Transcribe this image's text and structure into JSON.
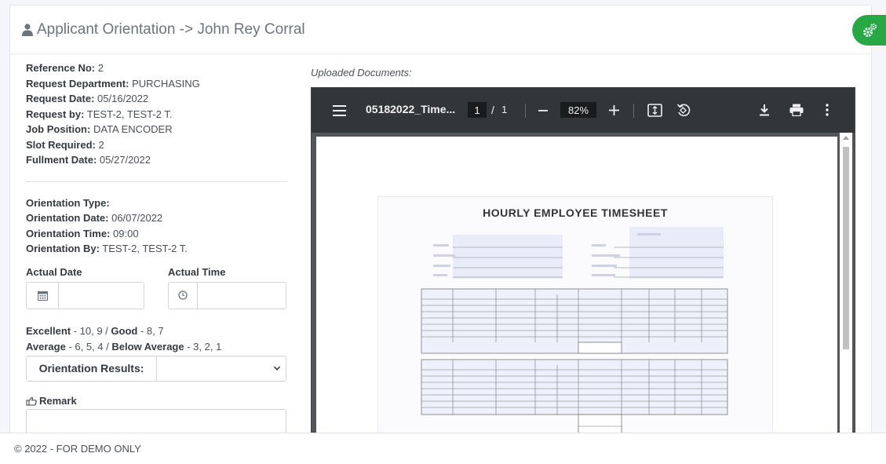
{
  "header": {
    "title": "Applicant Orientation -> John Rey Corral",
    "icon": "user-icon"
  },
  "request": {
    "fields": [
      {
        "label": "Reference No:",
        "value": "2"
      },
      {
        "label": "Request Department:",
        "value": "PURCHASING"
      },
      {
        "label": "Request Date:",
        "value": "05/16/2022"
      },
      {
        "label": "Request by:",
        "value": "TEST-2, TEST-2 T."
      },
      {
        "label": "Job Position:",
        "value": "DATA ENCODER"
      },
      {
        "label": "Slot Required:",
        "value": "2"
      },
      {
        "label": "Fullment Date:",
        "value": "05/27/2022"
      }
    ]
  },
  "orientation": {
    "fields": [
      {
        "label": "Orientation Type:",
        "value": ""
      },
      {
        "label": "Orientation Date:",
        "value": "06/07/2022"
      },
      {
        "label": "Orientation Time:",
        "value": "09:00"
      },
      {
        "label": "Orientation By:",
        "value": "TEST-2, TEST-2 T."
      }
    ]
  },
  "actual": {
    "date_label": "Actual Date",
    "time_label": "Actual Time",
    "date_value": "",
    "time_value": ""
  },
  "rating": {
    "excellent_label": "Excellent",
    "excellent_values": " - 10, 9 / ",
    "good_label": "Good",
    "good_values": " - 8, 7",
    "average_label": "Average",
    "average_values": " - 6, 5, 4 / ",
    "below_label": "Below Average",
    "below_values": " - 3, 2, 1"
  },
  "results": {
    "label": "Orientation Results:",
    "selected": ""
  },
  "remark": {
    "label": "Remark",
    "value": ""
  },
  "documents": {
    "label": "Uploaded Documents:",
    "viewer": {
      "file_name": "05182022_Time...",
      "current_page": "1",
      "page_sep": "/",
      "total_pages": "1",
      "zoom": "82%",
      "sheet_title": "HOURLY EMPLOYEE TIMESHEET"
    }
  },
  "footer": {
    "text": "© 2022 - FOR DEMO ONLY"
  },
  "colors": {
    "accent": "#28a745",
    "toolbar": "#323639",
    "viewer_bg": "#525659"
  }
}
